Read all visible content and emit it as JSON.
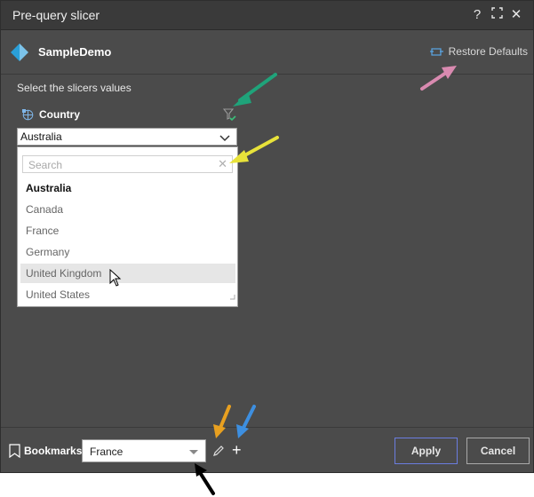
{
  "window": {
    "title": "Pre-query slicer"
  },
  "titlebar": {
    "help_glyph": "?",
    "close_glyph": "✕"
  },
  "header": {
    "model_name": "SampleDemo",
    "restore_label": "Restore Defaults"
  },
  "instructions": "Select the slicers values",
  "slicer": {
    "label": "Country",
    "selected_value": "Australia",
    "search_placeholder": "Search",
    "options": [
      {
        "label": "Australia",
        "state": "selected"
      },
      {
        "label": "Canada",
        "state": ""
      },
      {
        "label": "France",
        "state": ""
      },
      {
        "label": "Germany",
        "state": ""
      },
      {
        "label": "United Kingdom",
        "state": "hover"
      },
      {
        "label": "United States",
        "state": ""
      }
    ]
  },
  "footer": {
    "bookmarks_label": "Bookmarks",
    "bookmark_value": "France",
    "apply_label": "Apply",
    "cancel_label": "Cancel"
  },
  "annotation_colors": {
    "green": "#1fa37a",
    "yellow": "#e8e23a",
    "pink": "#d98ab0",
    "orange": "#e8a020",
    "blue": "#3d8fe0",
    "black": "#000000"
  }
}
